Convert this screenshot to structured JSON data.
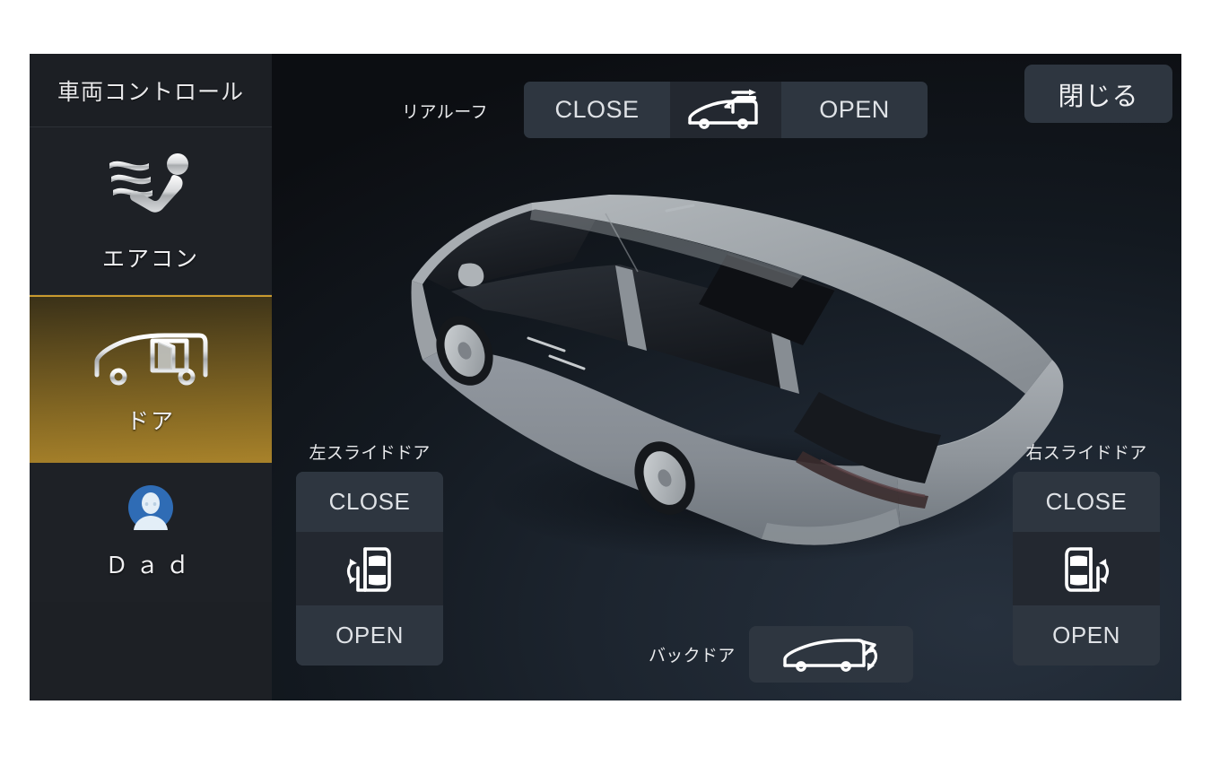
{
  "sidebar": {
    "header": "車両コントロール",
    "items": [
      {
        "id": "aircon",
        "label": "エアコン",
        "icon": "seat-airflow-icon",
        "selected": false
      },
      {
        "id": "door",
        "label": "ドア",
        "icon": "car-door-icon",
        "selected": true
      }
    ],
    "profile": {
      "label": "Ｄａｄ",
      "icon": "user-avatar-icon",
      "avatar_color": "#2f6cb5"
    }
  },
  "topbar": {
    "rear_roof_label": "リアルーフ",
    "rear_roof_close": "CLOSE",
    "rear_roof_open": "OPEN",
    "rear_roof_icon": "car-sunroof-icon",
    "close_button": "閉じる"
  },
  "left_door": {
    "title": "左スライドドア",
    "close": "CLOSE",
    "open": "OPEN",
    "icon": "sliding-door-left-icon"
  },
  "right_door": {
    "title": "右スライドドア",
    "close": "CLOSE",
    "open": "OPEN",
    "icon": "sliding-door-right-icon"
  },
  "back_door": {
    "label": "バックドア",
    "icon": "back-door-icon"
  },
  "vehicle": {
    "name": "minivan-3d-render",
    "body_color": "#9aa0a4",
    "sunroof_color": "#101216"
  },
  "colors": {
    "accent_gold": "#c99a2e",
    "button_fill": "#2e3640",
    "button_icon_fill": "#232830",
    "sidebar_bg": "#1e2126",
    "text_primary": "#e9eaec"
  }
}
